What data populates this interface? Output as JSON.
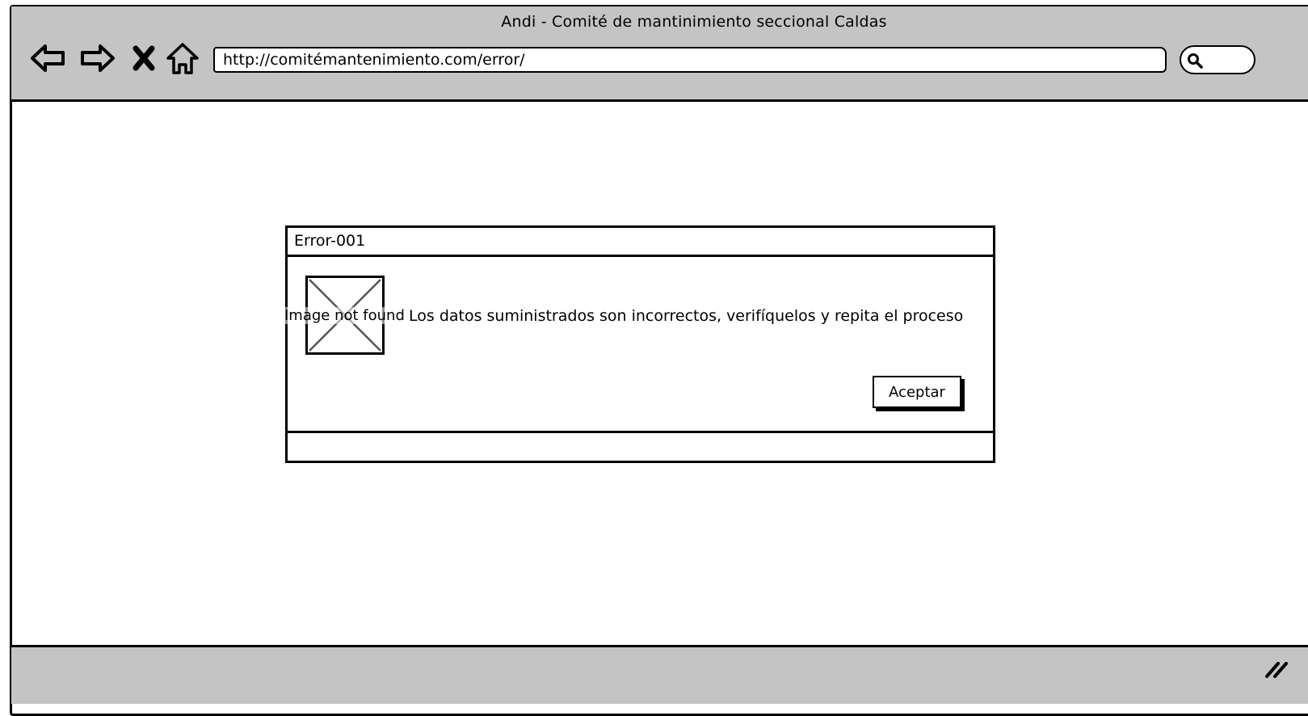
{
  "browser": {
    "title": "Andi - Comité de mantinimiento seccional Caldas",
    "url": "http://comitémantenimiento.com/error/",
    "nav_icons": [
      "back-arrow-icon",
      "forward-arrow-icon",
      "close-icon",
      "home-icon"
    ],
    "search_icon": "search-icon",
    "resize_icon": "resize-grip-icon"
  },
  "dialog": {
    "title": "Error-001",
    "image_placeholder_text": "Image not found",
    "message": "Los datos suministrados son incorrectos, verifíquelos y repita el proceso",
    "accept_label": "Aceptar"
  },
  "colors": {
    "chrome_gray": "#c4c4c4",
    "stroke": "#000000",
    "background": "#ffffff"
  }
}
